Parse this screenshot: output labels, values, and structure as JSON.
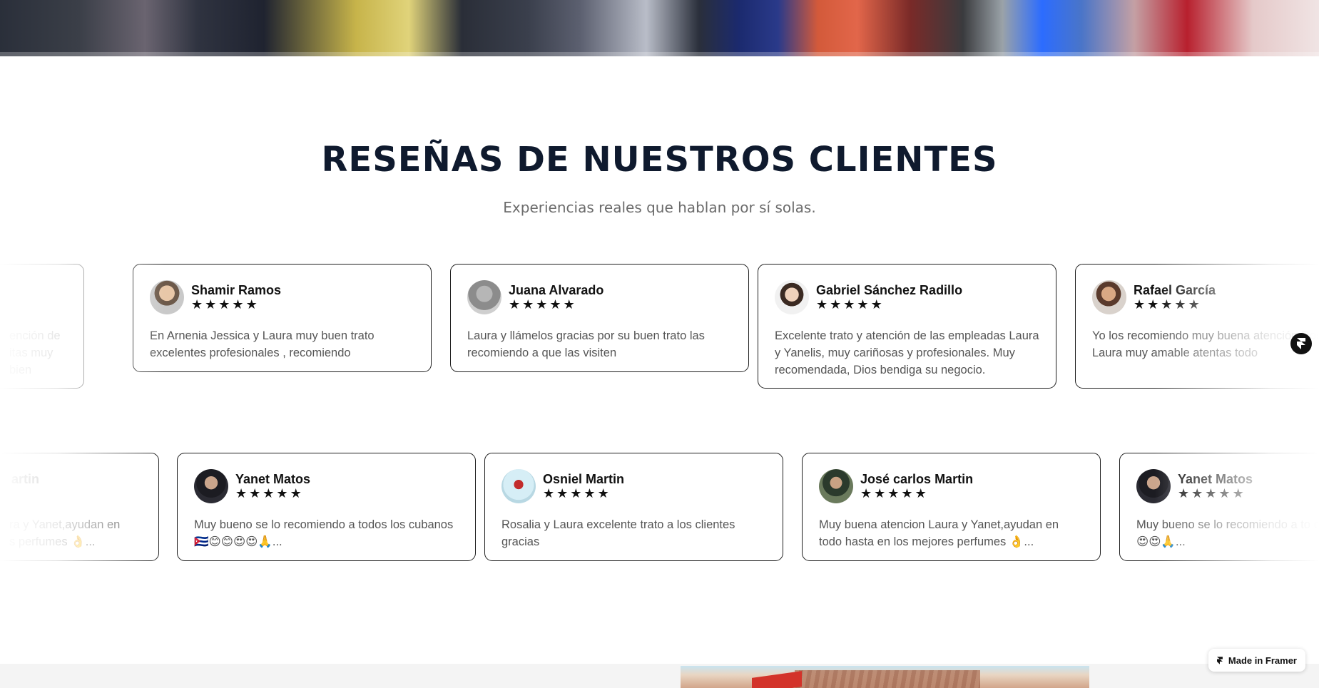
{
  "section": {
    "title": "RESEÑAS DE NUESTROS CLIENTES",
    "subtitle": "Experiencias reales que hablan por sí solas."
  },
  "reviews_row_1": [
    {
      "name": "",
      "rating": 5,
      "text": "ención de\nitas muy bien"
    },
    {
      "name": "Shamir Ramos",
      "rating": 5,
      "text": "En Arnenia Jessica y Laura muy buen trato excelentes profesionales , recomiendo"
    },
    {
      "name": "Juana Alvarado",
      "rating": 5,
      "text": "Laura y llámelos gracias por su buen trato las recomiendo a que las visiten"
    },
    {
      "name": "Gabriel Sánchez Radillo",
      "rating": 5,
      "text": "Excelente trato y atención de las empleadas Laura y Yanelis, muy cariñosas y profesionales. Muy recomendada, Dios bendiga su negocio."
    },
    {
      "name": "Rafael García",
      "rating": 5,
      "text": "Yo los recomiendo muy buena atención Rosalía y Laura muy amable atentas todo"
    }
  ],
  "reviews_row_2": [
    {
      "name": "artin",
      "rating": 5,
      "text": "ra y Yanet,ayudan en\ns perfumes 👌..."
    },
    {
      "name": "Yanet Matos",
      "rating": 5,
      "text": "Muy bueno se lo recomiendo a todos los cubanos 🇨🇺😊😊😍😍🙏..."
    },
    {
      "name": "Osniel Martin",
      "rating": 5,
      "text": "Rosalia y Laura excelente trato a los clientes gracias"
    },
    {
      "name": "José carlos Martin",
      "rating": 5,
      "text": "Muy buena atencion Laura y Yanet,ayudan en todo hasta en los mejores perfumes 👌..."
    },
    {
      "name": "Yanet Matos",
      "rating": 5,
      "text": "Muy bueno se lo recomiendo a to cubanos 🇨🇺😊😊😍😍🙏..."
    }
  ],
  "framer_badge": {
    "label": "Made in Framer"
  },
  "icons": {
    "star": "star-icon",
    "framer": "framer-logo-icon"
  },
  "colors": {
    "title": "#0f1a2e",
    "subtitle": "#6b6b6b",
    "card_border": "#1f1f1f",
    "review_text": "#555555"
  }
}
